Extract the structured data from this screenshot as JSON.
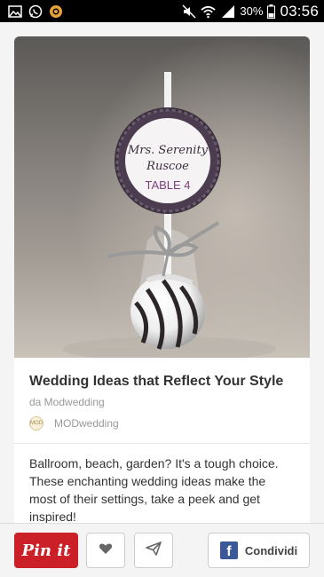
{
  "status_bar": {
    "battery": "30%",
    "time": "03:56",
    "icons": [
      "gallery-icon",
      "whatsapp-icon",
      "app-icon",
      "mute-icon",
      "wifi-icon",
      "signal-icon",
      "battery-icon"
    ]
  },
  "pin": {
    "image": {
      "tag_line1": "Mrs. Serenity",
      "tag_line2": "Ruscoe",
      "tag_line3": "TABLE 4"
    },
    "title": "Wedding Ideas that Reflect Your Style",
    "source": "da Modwedding",
    "board_avatar_text": "MOD",
    "board_name": "MODwedding",
    "description": "Ballroom, beach, garden? It's a tough choice. These enchanting wedding ideas make the most of their settings, take a peek and get inspired!"
  },
  "actions": {
    "pin_label": "Pin it",
    "share_icon_letter": "f",
    "share_label": "Condividi"
  },
  "colors": {
    "pin_red": "#cb2027",
    "facebook_blue": "#3b5998"
  }
}
